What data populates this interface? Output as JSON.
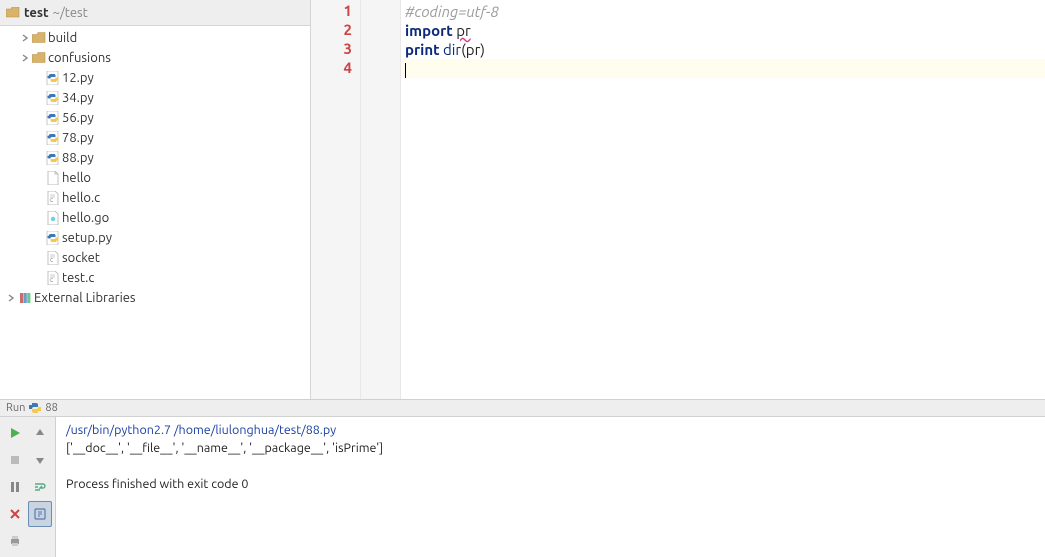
{
  "breadcrumb": {
    "name": "test",
    "path": "~/test"
  },
  "tree": [
    {
      "kind": "folder",
      "label": "build",
      "indent": 14,
      "expandable": true,
      "expanded": false
    },
    {
      "kind": "folder",
      "label": "confusions",
      "indent": 14,
      "expandable": true,
      "expanded": false
    },
    {
      "kind": "py",
      "label": "12.py",
      "indent": 28
    },
    {
      "kind": "py",
      "label": "34.py",
      "indent": 28
    },
    {
      "kind": "py",
      "label": "56.py",
      "indent": 28
    },
    {
      "kind": "py",
      "label": "78.py",
      "indent": 28
    },
    {
      "kind": "py",
      "label": "88.py",
      "indent": 28
    },
    {
      "kind": "file",
      "label": "hello",
      "indent": 28
    },
    {
      "kind": "c",
      "label": "hello.c",
      "indent": 28
    },
    {
      "kind": "go",
      "label": "hello.go",
      "indent": 28
    },
    {
      "kind": "py",
      "label": "setup.py",
      "indent": 28
    },
    {
      "kind": "c",
      "label": "socket",
      "indent": 28
    },
    {
      "kind": "c",
      "label": "test.c",
      "indent": 28
    },
    {
      "kind": "lib",
      "label": "External Libraries",
      "indent": 0,
      "expandable": true,
      "expanded": false
    }
  ],
  "code": {
    "lines": [
      {
        "n": "1",
        "html": "<span class='cm'>#coding=utf-8</span>",
        "current": false
      },
      {
        "n": "2",
        "html": "<span class='kw'>import</span> <span class='txt underline-red'>pr</span>",
        "current": false
      },
      {
        "n": "3",
        "html": "<span class='kw'>print</span> <span class='fn'>dir</span><span class='txt'>(pr)</span>",
        "current": false
      },
      {
        "n": "4",
        "html": "",
        "current": true
      }
    ]
  },
  "run": {
    "label": "Run",
    "config": "88"
  },
  "console": {
    "cmd": "/usr/bin/python2.7 /home/liulonghua/test/88.py",
    "out_lines": [
      "['__doc__', '__file__', '__name__', '__package__', 'isPrime']",
      "",
      "Process finished with exit code 0"
    ]
  }
}
